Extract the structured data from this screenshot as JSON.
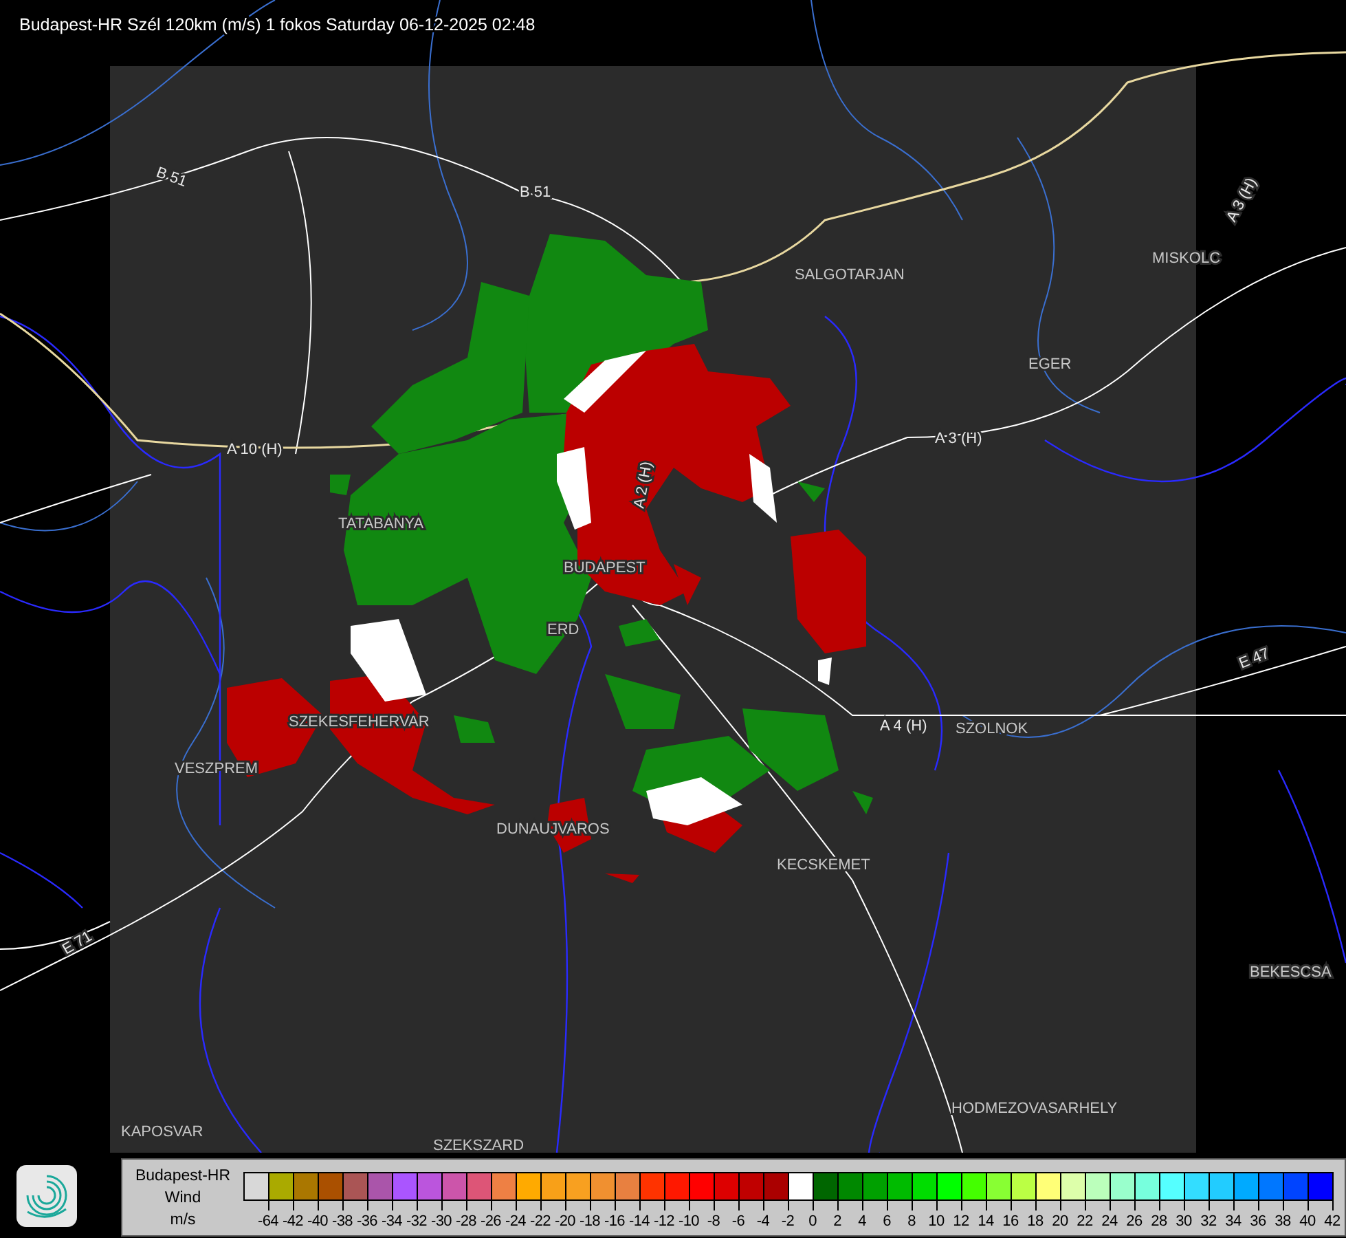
{
  "title": "Budapest-HR Szél 120km (m/s) 1 fokos Saturday 06-12-2025 02:48",
  "map": {
    "cities": [
      {
        "name": "SALGOTARJAN"
      },
      {
        "name": "EGER"
      },
      {
        "name": "MISKOLC"
      },
      {
        "name": "TATABANYA"
      },
      {
        "name": "BUDAPEST"
      },
      {
        "name": "ERD"
      },
      {
        "name": "SZEKESFEHERVAR"
      },
      {
        "name": "VESZPREM"
      },
      {
        "name": "DUNAUJVAROS"
      },
      {
        "name": "KECSKEMET"
      },
      {
        "name": "SZOLNOK"
      },
      {
        "name": "BEKESCSA"
      },
      {
        "name": "HODMEZOVASARHELY"
      },
      {
        "name": "KAPOSVAR"
      },
      {
        "name": "SZEKSZARD"
      }
    ],
    "roads": [
      {
        "label": "B 51"
      },
      {
        "label": "B 51"
      },
      {
        "label": "A 10 (H)"
      },
      {
        "label": "A 3 (H)"
      },
      {
        "label": "A 3 (H)"
      },
      {
        "label": "A 2 (H)"
      },
      {
        "label": "A 4 (H)"
      },
      {
        "label": "E 71"
      },
      {
        "label": "E 47"
      }
    ]
  },
  "legend": {
    "title_lines": [
      "Budapest-HR",
      "Wind",
      "m/s"
    ],
    "swatches": [
      {
        "color": "#d8d8d8"
      },
      {
        "color": "#aaaa00"
      },
      {
        "color": "#aa7700"
      },
      {
        "color": "#aa5000"
      },
      {
        "color": "#aa5555"
      },
      {
        "color": "#aa55aa"
      },
      {
        "color": "#aa55ff"
      },
      {
        "color": "#bb55dd"
      },
      {
        "color": "#cc55aa"
      },
      {
        "color": "#dd5577"
      },
      {
        "color": "#ee8044"
      },
      {
        "color": "#ffaa00"
      },
      {
        "color": "#f8a018"
      },
      {
        "color": "#f8a020"
      },
      {
        "color": "#f09030"
      },
      {
        "color": "#e88040"
      },
      {
        "color": "#ff3300"
      },
      {
        "color": "#ff1800"
      },
      {
        "color": "#ff0000"
      },
      {
        "color": "#dd0000"
      },
      {
        "color": "#c00000"
      },
      {
        "color": "#aa0000"
      },
      {
        "color": "#ffffff"
      },
      {
        "color": "#006600"
      },
      {
        "color": "#008800"
      },
      {
        "color": "#00a000"
      },
      {
        "color": "#00bb00"
      },
      {
        "color": "#00dd00"
      },
      {
        "color": "#00ff00"
      },
      {
        "color": "#44ff00"
      },
      {
        "color": "#88ff33"
      },
      {
        "color": "#bbff44"
      },
      {
        "color": "#ffff77"
      },
      {
        "color": "#ddffaa"
      },
      {
        "color": "#bbffbb"
      },
      {
        "color": "#99ffcc"
      },
      {
        "color": "#77ffdd"
      },
      {
        "color": "#55ffff"
      },
      {
        "color": "#33ddff"
      },
      {
        "color": "#22ccff"
      },
      {
        "color": "#00aaff"
      },
      {
        "color": "#0077ff"
      },
      {
        "color": "#0044ff"
      },
      {
        "color": "#0000ff"
      }
    ],
    "ticks": [
      "-64",
      "-42",
      "-40",
      "-38",
      "-36",
      "-34",
      "-32",
      "-30",
      "-28",
      "-26",
      "-24",
      "-22",
      "-20",
      "-18",
      "-16",
      "-14",
      "-12",
      "-10",
      "-8",
      "-6",
      "-4",
      "-2",
      "0",
      "2",
      "4",
      "6",
      "8",
      "10",
      "12",
      "14",
      "16",
      "18",
      "20",
      "22",
      "24",
      "26",
      "28",
      "30",
      "32",
      "34",
      "36",
      "38",
      "40",
      "42"
    ]
  }
}
